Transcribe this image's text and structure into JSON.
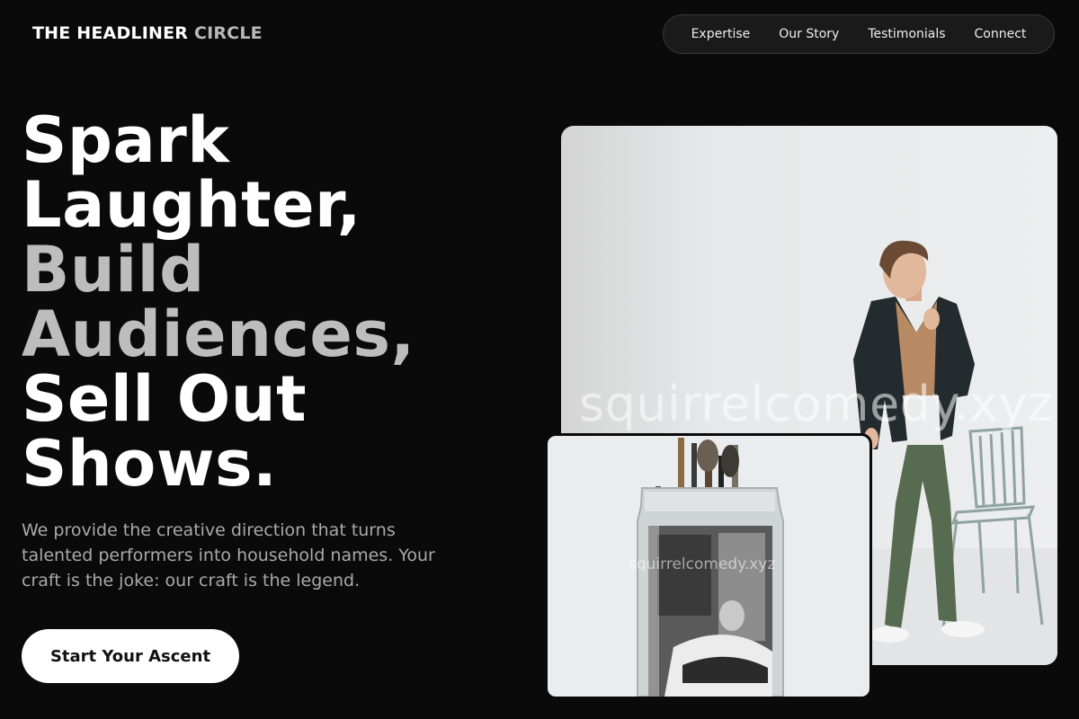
{
  "brand": {
    "part1": "THE HEADLINER",
    "part2": "CIRCLE"
  },
  "nav": {
    "items": [
      "Expertise",
      "Our Story",
      "Testimonials",
      "Connect"
    ]
  },
  "hero": {
    "headline": {
      "line1": "Spark",
      "line2": "Laughter,",
      "line3": "Build",
      "line4": "Audiences,",
      "line5": "Sell Out",
      "line6": "Shows."
    },
    "subtext": "We provide the creative direction that turns talented performers into household names. Your craft is the joke: our craft is the legend.",
    "cta_label": "Start Your Ascent"
  },
  "images": {
    "main_watermark": "squirrelcomedy.xyz",
    "small_watermark": "squirrelcomedy.xyz"
  },
  "colors": {
    "background": "#0a0a0a",
    "headline_primary": "#ffffff",
    "headline_accent": "#bdbdbd",
    "cta_background": "#ffffff"
  }
}
